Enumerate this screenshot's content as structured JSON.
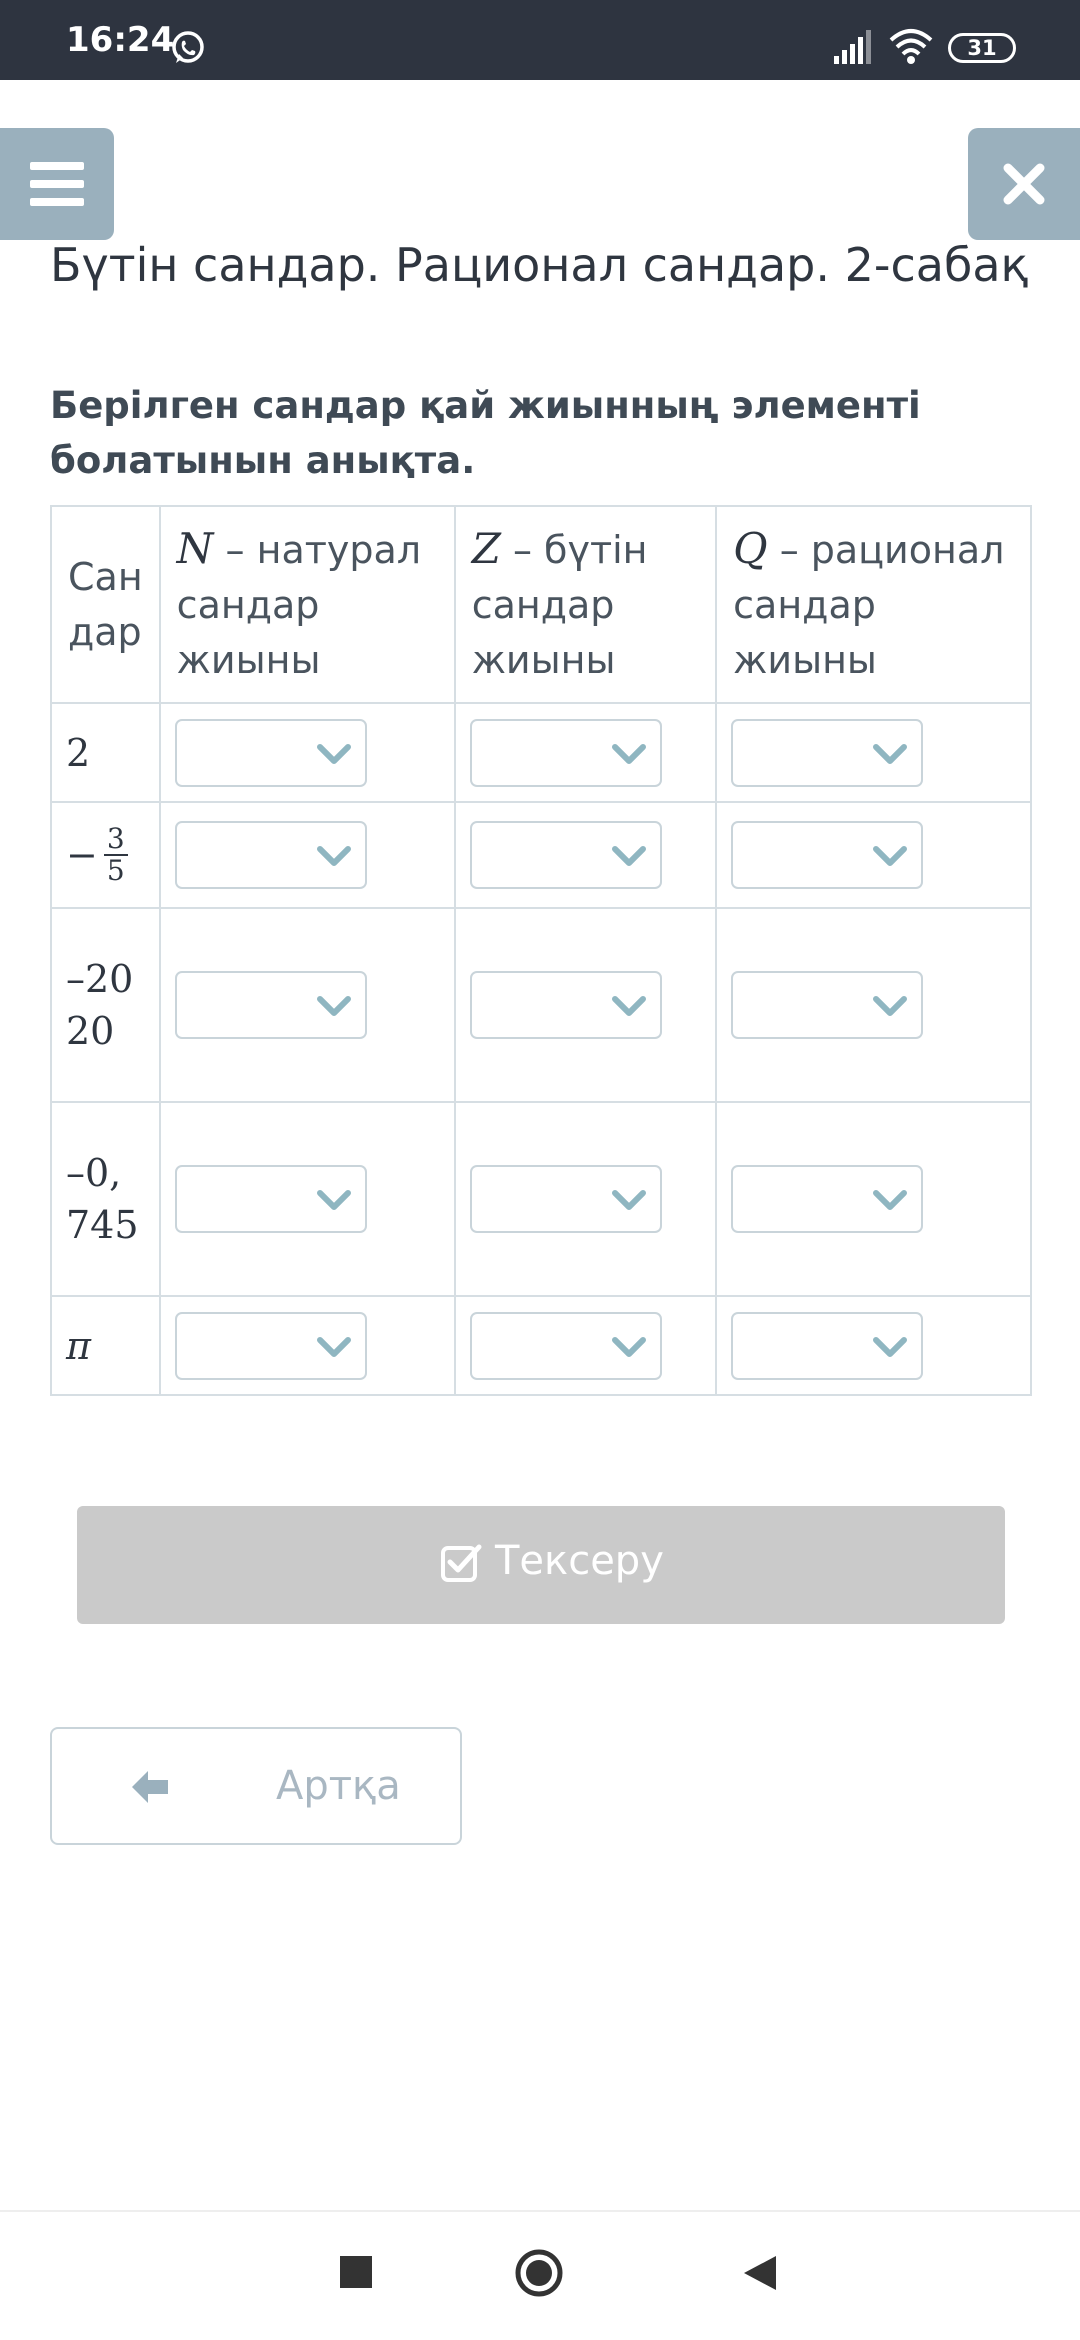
{
  "status_bar": {
    "time": "16:24",
    "battery": "31"
  },
  "page_title": "Бүтін сандар. Рационал сандар. 2-сабақ",
  "question": "Берілген сандар қай жиынның элементі болатынын анықта.",
  "table": {
    "first_header": "Сан дар",
    "columns": [
      {
        "symbol": "N",
        "label": "– натурал сандар жиыны"
      },
      {
        "symbol": "Z",
        "label": "– бүтін сандар жиыны"
      },
      {
        "symbol": "Q",
        "label": "– рационал сандар жиыны"
      }
    ],
    "rows": [
      {
        "number": "2"
      },
      {
        "sign": "−",
        "numerator": "3",
        "denominator": "5"
      },
      {
        "number": "–2020"
      },
      {
        "number": "–0,745"
      },
      {
        "number": "π"
      }
    ],
    "dropdown_value": ""
  },
  "buttons": {
    "check": "Тексеру",
    "back": "Артқа"
  },
  "icons": [
    "whatsapp-icon",
    "signal-icon",
    "wifi-icon",
    "menu-icon",
    "close-icon",
    "chevron-down-icon",
    "checkbox-icon",
    "arrow-left-icon"
  ],
  "colors": {
    "status_bar": "#2e3440",
    "accent": "#9ab0bd",
    "chevron": "#8fb6c1",
    "check_button": "#cacaca"
  }
}
